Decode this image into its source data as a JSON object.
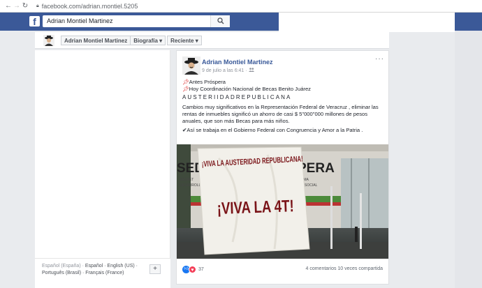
{
  "browser": {
    "url": "facebook.com/adrian.montiel.5205"
  },
  "topbar": {
    "logo": "f",
    "search_value": "Adrian Montiel Martinez"
  },
  "subheader": {
    "name": "Adrian Montiel Martinez",
    "tab_bio": "Biografía ▾",
    "tab_recent": "Reciente ▾"
  },
  "footer_links": {
    "line1_dim": "Español (España) · ",
    "line1_a": "Español",
    "line1_sep": " · ",
    "line1_b": "English (US)",
    "line1_tail": " ·",
    "line2": "Português (Brasil) · Français (France)",
    "plus": "+"
  },
  "post": {
    "author": "Adrian Montiel Martinez",
    "date": "9 de julio a las 6:41 · ",
    "more": "···",
    "line1": "Antes Próspera",
    "line2": "Hoy Coordinación Nacional de Becas Benito Juárez",
    "line3": "AUSTERIIDADREPUBLICANA",
    "paragraph": "Cambios muy significativos en la Representación Federal de Veracruz , eliminar las rentas de inmuebles significó un ahorro de casi $ 5\"000\"000 millones de pesos anuales, que son más Becas para más niños.",
    "closing": "Así se trabaja en el Gobierno Federal con Congruencia y Amor a la Patria .",
    "reactions_count": "37",
    "stats": "4 comentarios  10 veces compartida"
  },
  "photo": {
    "banner_line1": "¡VIVA LA AUSTERIDAD REPUBLICANA!",
    "banner_line2": "¡VIVA LA 4T!",
    "wall_left": "SEDI",
    "wall_right": "PERA",
    "small_left_1": "SECRET",
    "small_left_2": "DESARROLL",
    "small_right_1": "AMA",
    "small_right_2": "N SOCIAL"
  },
  "colors": {
    "fb_blue": "#3b5998",
    "link": "#385898",
    "banner_text": "#7a1418"
  },
  "icons": [
    "back-arrow-icon",
    "forward-arrow-icon",
    "reload-icon",
    "lock-icon",
    "facebook-logo-icon",
    "search-icon",
    "pin-icon",
    "check-icon",
    "like-icon",
    "love-icon",
    "friends-icon",
    "more-icon"
  ]
}
